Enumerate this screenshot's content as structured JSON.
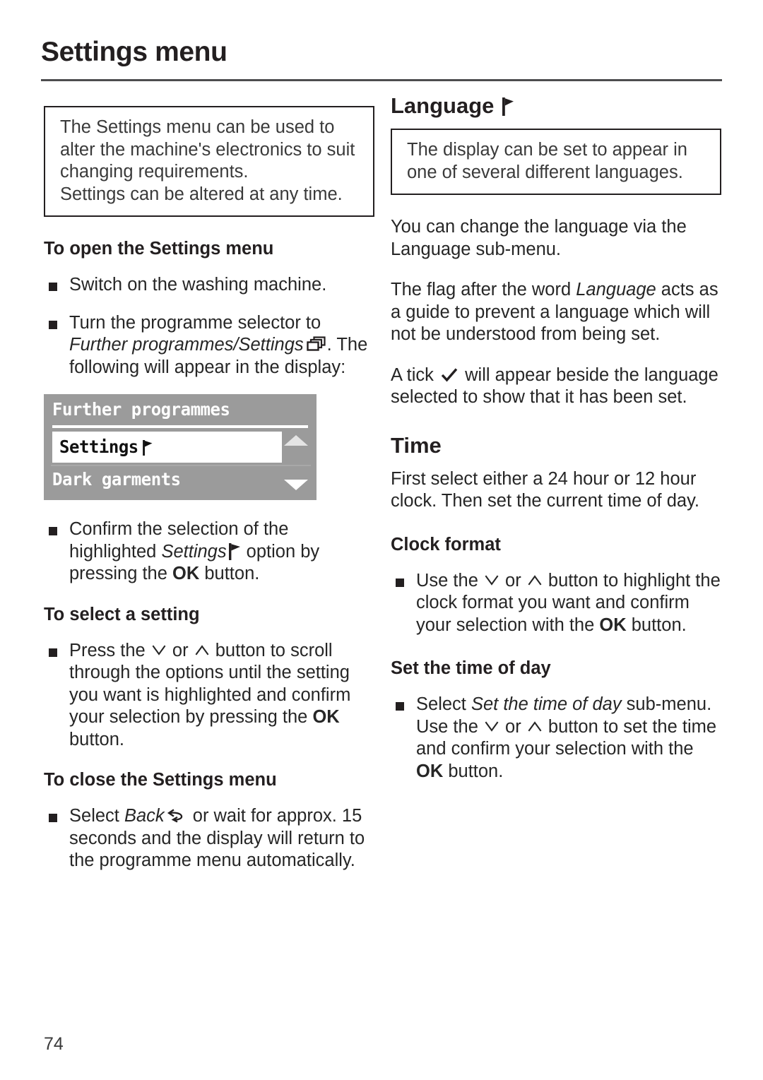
{
  "header": {
    "title": "Settings menu"
  },
  "footer": {
    "page_number": "74"
  },
  "left_column": {
    "intro_box": {
      "line1": "The Settings menu can be used to alter the machine's electronics to suit changing requirements.",
      "line2": "Settings can be altered at any time."
    },
    "open_section": {
      "heading": "To open the Settings menu",
      "bullet1": "Switch on the washing machine.",
      "bullet2_part1": "Turn the programme selector to ",
      "bullet2_italic": "Further programmes/Settings",
      "bullet2_part2": ". The following will appear in the display:",
      "bullet3_part1": "Confirm the selection of the highlighted ",
      "bullet3_italic": "Settings",
      "bullet3_part2": " option by pressing the ",
      "bullet3_bold": "OK",
      "bullet3_part3": " button."
    },
    "lcd": {
      "title": "Further programmes",
      "selected_row": "Settings",
      "selected_row_icon": "flag-icon",
      "second_row": "Dark garments",
      "scroll_up_icon": "triangle-up-icon",
      "scroll_down_icon": "triangle-down-icon",
      "background_color": "#9b9b9b",
      "highlight_color": "#ffffff"
    },
    "select_section": {
      "heading": "To select a setting",
      "bullet1_part1": "Press the ",
      "bullet1_part2": " or ",
      "bullet1_part3": " button to scroll through the options until the setting you want is highlighted and confirm your selection by pressing the ",
      "bullet1_bold": "OK",
      "bullet1_part4": " button."
    },
    "close_section": {
      "heading": "To close the Settings menu",
      "bullet1_part1": "Select ",
      "bullet1_italic": "Back",
      "bullet1_part2": " or wait for approx. 15 seconds and the display will return to the programme menu automatically."
    }
  },
  "right_column": {
    "language": {
      "heading": "Language",
      "heading_icon": "flag-icon",
      "box_text": "The display can be set to appear in one of several different languages.",
      "para1": "You can change the language via the Language sub-menu.",
      "para2_part1": "The flag after the word ",
      "para2_italic": "Language",
      "para2_part2": " acts as a guide to prevent a language which will not be understood from being set.",
      "para3_part1": "A tick ",
      "para3_part2": " will appear beside the language selected to show that it has been set."
    },
    "time": {
      "heading": "Time",
      "para1": "First select either a 24 hour or 12 hour clock. Then set the current time of day.",
      "clock_format": {
        "heading": "Clock format",
        "bullet1_part1": "Use the ",
        "bullet1_part2": " or ",
        "bullet1_part3": " button to highlight the clock format you want and confirm your selection with the ",
        "bullet1_bold": "OK",
        "bullet1_part4": " button."
      },
      "set_time": {
        "heading": "Set the time of day",
        "bullet1_part1": "Select ",
        "bullet1_italic": "Set the time of day",
        "bullet1_part2": " sub-menu. Use the ",
        "bullet1_part3": " or ",
        "bullet1_part4": " button to set the time and confirm your selection with the ",
        "bullet1_bold": "OK",
        "bullet1_part5": " button."
      }
    }
  },
  "icons": {
    "flag": "flag-icon",
    "stacked_pages": "stacked-pages-icon",
    "tick": "tick-icon",
    "back_arrow": "back-arrow-icon",
    "chevron_down": "chevron-down-icon",
    "chevron_up": "chevron-up-icon"
  }
}
